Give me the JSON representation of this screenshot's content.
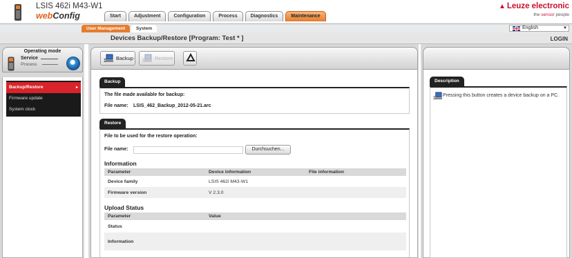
{
  "header": {
    "device_title": "LSIS 462i M43-W1",
    "app_name_prefix": "web",
    "app_name_suffix": "Config",
    "brand": "Leuze electronic",
    "slogan_prefix": "the ",
    "slogan_accent": "sensor",
    "slogan_suffix": " people"
  },
  "main_tabs": [
    {
      "label": "Start",
      "active": false
    },
    {
      "label": "Adjustment",
      "active": false
    },
    {
      "label": "Configuration",
      "active": false
    },
    {
      "label": "Process",
      "active": false
    },
    {
      "label": "Diagnostics",
      "active": false
    },
    {
      "label": "Maintenance",
      "active": true
    }
  ],
  "sub_tabs": [
    {
      "label": "User Management"
    },
    {
      "label": "System"
    }
  ],
  "language": {
    "selected": "English"
  },
  "titlebar": {
    "title": "Devices Backup/Restore   [Program: Test * ]",
    "login": "LOGIN"
  },
  "operating_mode": {
    "title": "Operating mode",
    "service": "Service",
    "process": "Process"
  },
  "nav": {
    "items": [
      {
        "label": "Backup/Restore",
        "active": true
      },
      {
        "label": "Firmware update",
        "active": false
      },
      {
        "label": "System clock",
        "active": false
      }
    ]
  },
  "toolbar": {
    "backup_label": "Backup",
    "restore_label": "Restore"
  },
  "backup_section": {
    "tab": "Backup",
    "available_text": "The file made available for backup:",
    "file_name_label": "File name:",
    "file_name_value": "LSIS_462_Backup_2012-05-21.arc"
  },
  "restore_section": {
    "tab": "Restore",
    "restore_text": "File to be used for the restore operation:",
    "file_name_label": "File name:",
    "file_input_value": "",
    "browse_button": "Durchsuchen..."
  },
  "information": {
    "heading": "Information",
    "columns": [
      "Parameter",
      "Device information",
      "File information"
    ],
    "rows": [
      {
        "parameter": "Device family",
        "device": "LSIS 462i M43-W1",
        "file": ""
      },
      {
        "parameter": "Firmware version",
        "device": "V 2.3.0",
        "file": ""
      }
    ]
  },
  "upload_status": {
    "heading": "Upload Status",
    "columns": [
      "Parameter",
      "Value"
    ],
    "rows": [
      {
        "parameter": "Status",
        "value": ""
      },
      {
        "parameter": "Information",
        "value": ""
      }
    ]
  },
  "description": {
    "tab": "Description",
    "text": "Pressing this button creates a device backup on a PC."
  },
  "colors": {
    "accent_orange": "#e57c2e",
    "nav_active_red": "#d8232a",
    "brand_red": "#c8102e"
  }
}
